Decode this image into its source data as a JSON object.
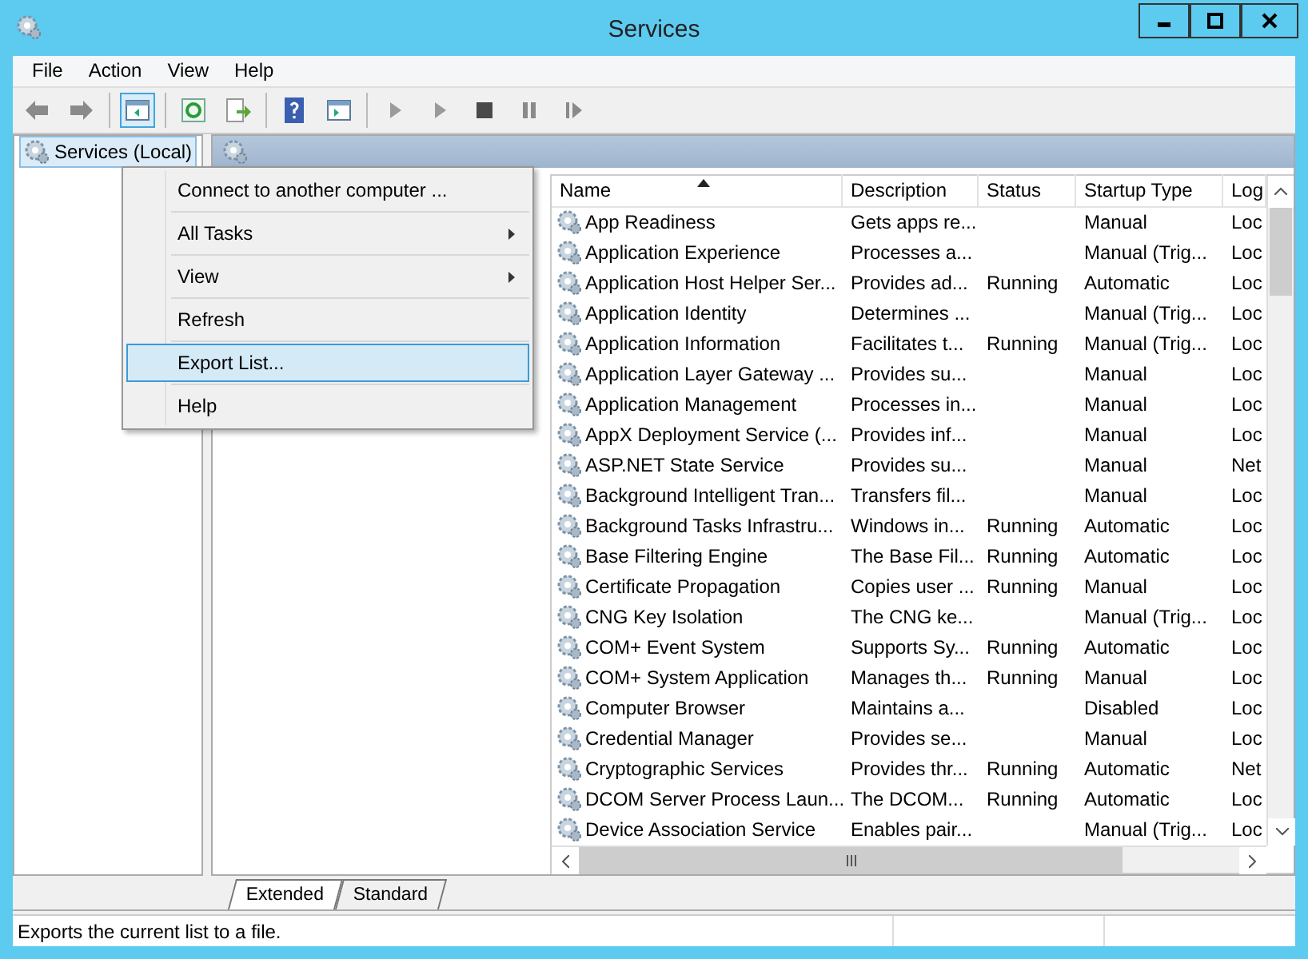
{
  "window": {
    "title": "Services"
  },
  "menu": [
    "File",
    "Action",
    "View",
    "Help"
  ],
  "tree": {
    "label": "Services (Local)",
    "selected": true
  },
  "columns": [
    {
      "label": "Name",
      "sorted": true
    },
    {
      "label": "Description",
      "sorted": false
    },
    {
      "label": "Status",
      "sorted": false
    },
    {
      "label": "Startup Type",
      "sorted": false
    },
    {
      "label": "Log",
      "sorted": false
    }
  ],
  "rows": [
    {
      "name": "App Readiness",
      "description": "Gets apps re...",
      "status": "",
      "startup": "Manual",
      "log": "Loc"
    },
    {
      "name": "Application Experience",
      "description": "Processes a...",
      "status": "",
      "startup": "Manual (Trig...",
      "log": "Loc"
    },
    {
      "name": "Application Host Helper Ser...",
      "description": "Provides ad...",
      "status": "Running",
      "startup": "Automatic",
      "log": "Loc"
    },
    {
      "name": "Application Identity",
      "description": "Determines ...",
      "status": "",
      "startup": "Manual (Trig...",
      "log": "Loc"
    },
    {
      "name": "Application Information",
      "description": "Facilitates t...",
      "status": "Running",
      "startup": "Manual (Trig...",
      "log": "Loc"
    },
    {
      "name": "Application Layer Gateway ...",
      "description": "Provides su...",
      "status": "",
      "startup": "Manual",
      "log": "Loc"
    },
    {
      "name": "Application Management",
      "description": "Processes in...",
      "status": "",
      "startup": "Manual",
      "log": "Loc"
    },
    {
      "name": "AppX Deployment Service (...",
      "description": "Provides inf...",
      "status": "",
      "startup": "Manual",
      "log": "Loc"
    },
    {
      "name": "ASP.NET State Service",
      "description": "Provides su...",
      "status": "",
      "startup": "Manual",
      "log": "Net"
    },
    {
      "name": "Background Intelligent Tran...",
      "description": "Transfers fil...",
      "status": "",
      "startup": "Manual",
      "log": "Loc"
    },
    {
      "name": "Background Tasks Infrastru...",
      "description": "Windows in...",
      "status": "Running",
      "startup": "Automatic",
      "log": "Loc"
    },
    {
      "name": "Base Filtering Engine",
      "description": "The Base Fil...",
      "status": "Running",
      "startup": "Automatic",
      "log": "Loc"
    },
    {
      "name": "Certificate Propagation",
      "description": "Copies user ...",
      "status": "Running",
      "startup": "Manual",
      "log": "Loc"
    },
    {
      "name": "CNG Key Isolation",
      "description": "The CNG ke...",
      "status": "",
      "startup": "Manual (Trig...",
      "log": "Loc"
    },
    {
      "name": "COM+ Event System",
      "description": "Supports Sy...",
      "status": "Running",
      "startup": "Automatic",
      "log": "Loc"
    },
    {
      "name": "COM+ System Application",
      "description": "Manages th...",
      "status": "Running",
      "startup": "Manual",
      "log": "Loc"
    },
    {
      "name": "Computer Browser",
      "description": "Maintains a...",
      "status": "",
      "startup": "Disabled",
      "log": "Loc"
    },
    {
      "name": "Credential Manager",
      "description": "Provides se...",
      "status": "",
      "startup": "Manual",
      "log": "Loc"
    },
    {
      "name": "Cryptographic Services",
      "description": "Provides thr...",
      "status": "Running",
      "startup": "Automatic",
      "log": "Net"
    },
    {
      "name": "DCOM Server Process Laun...",
      "description": "The DCOM...",
      "status": "Running",
      "startup": "Automatic",
      "log": "Loc"
    },
    {
      "name": "Device Association Service",
      "description": "Enables pair...",
      "status": "",
      "startup": "Manual (Trig...",
      "log": "Loc"
    }
  ],
  "context_menu": [
    {
      "label": "Connect to another computer ...",
      "submenu": false,
      "selected": false
    },
    {
      "label": "All Tasks",
      "submenu": true,
      "selected": false
    },
    {
      "label": "View",
      "submenu": true,
      "selected": false
    },
    {
      "label": "Refresh",
      "submenu": false,
      "selected": false
    },
    {
      "label": "Export List...",
      "submenu": false,
      "selected": true
    },
    {
      "label": "Help",
      "submenu": false,
      "selected": false
    }
  ],
  "tabs": [
    {
      "label": "Extended",
      "selected": true
    },
    {
      "label": "Standard",
      "selected": false
    }
  ],
  "status_bar": "Exports the current list to a file."
}
